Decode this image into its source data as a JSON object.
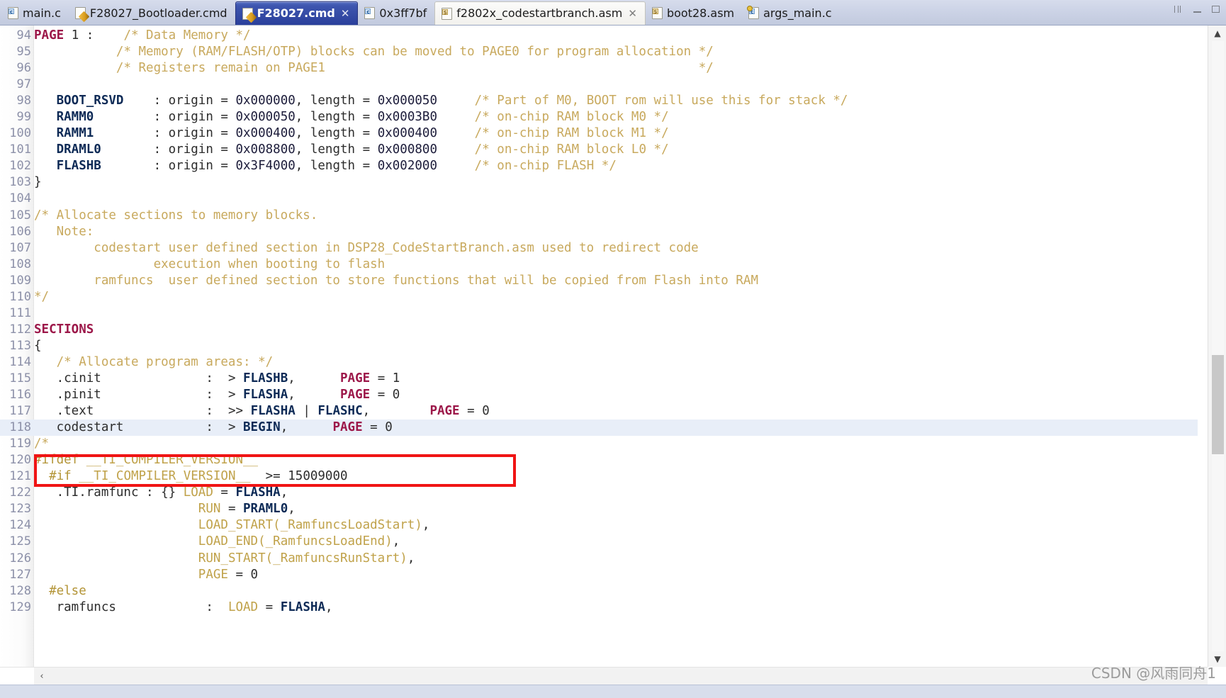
{
  "window": {
    "controls": [
      {
        "name": "restore-button",
        "glyph": "❐"
      },
      {
        "name": "minimize-button",
        "glyph": "—"
      },
      {
        "name": "maximize-button",
        "glyph": "▢"
      }
    ]
  },
  "tabs": [
    {
      "label": "main.c",
      "icon": "c-source-file-icon",
      "icon_kind": "c",
      "badge": "c",
      "active": false,
      "selected": false,
      "closable": false
    },
    {
      "label": "F28027_Bootloader.cmd",
      "icon": "linker-command-file-icon",
      "icon_kind": "cmd",
      "badge": "",
      "active": false,
      "selected": false,
      "closable": false
    },
    {
      "label": "F28027.cmd",
      "icon": "linker-command-file-icon",
      "icon_kind": "cmd",
      "badge": "",
      "active": true,
      "selected": true,
      "closable": true,
      "close_glyph": "✕"
    },
    {
      "label": "0x3ff7bf",
      "icon": "c-source-file-icon",
      "icon_kind": "c",
      "badge": "c",
      "active": false,
      "selected": false,
      "closable": false
    },
    {
      "label": "f2802x_codestartbranch.asm",
      "icon": "assembly-file-icon",
      "icon_kind": "asm",
      "badge": "S",
      "active": false,
      "selected": true,
      "closable": true,
      "close_glyph": "✕"
    },
    {
      "label": "boot28.asm",
      "icon": "assembly-file-icon",
      "icon_kind": "asm",
      "badge": "S",
      "active": false,
      "selected": false,
      "closable": false
    },
    {
      "label": "args_main.c",
      "icon": "c-source-file-icon",
      "icon_kind": "args",
      "badge": "c",
      "active": false,
      "selected": false,
      "closable": false
    }
  ],
  "editor": {
    "first_line": 94,
    "highlighted_line": 118,
    "annotation": {
      "shape": "rectangle",
      "color": "#f01414",
      "target_line": 118
    },
    "lines": [
      {
        "n": 94,
        "tokens": [
          {
            "t": "PAGE",
            "c": "k"
          },
          {
            "t": " 1 :    ",
            "c": "plain"
          },
          {
            "t": "/* Data Memory */",
            "c": "cmt"
          }
        ]
      },
      {
        "n": 95,
        "tokens": [
          {
            "t": "           ",
            "c": "plain"
          },
          {
            "t": "/* Memory (RAM/FLASH/OTP) blocks can be moved to PAGE0 for program allocation */",
            "c": "cmt"
          }
        ]
      },
      {
        "n": 96,
        "tokens": [
          {
            "t": "           ",
            "c": "plain"
          },
          {
            "t": "/* Registers remain on PAGE1                                                  */",
            "c": "cmt"
          }
        ]
      },
      {
        "n": 97,
        "tokens": []
      },
      {
        "n": 98,
        "tokens": [
          {
            "t": "   ",
            "c": "plain"
          },
          {
            "t": "BOOT_RSVD",
            "c": "ident"
          },
          {
            "t": "    : origin = ",
            "c": "plain"
          },
          {
            "t": "0x000000",
            "c": "num"
          },
          {
            "t": ", length = ",
            "c": "plain"
          },
          {
            "t": "0x000050",
            "c": "num"
          },
          {
            "t": "     ",
            "c": "plain"
          },
          {
            "t": "/* Part of M0, BOOT rom will use this for stack */",
            "c": "cmt"
          }
        ]
      },
      {
        "n": 99,
        "tokens": [
          {
            "t": "   ",
            "c": "plain"
          },
          {
            "t": "RAMM0",
            "c": "ident"
          },
          {
            "t": "        : origin = ",
            "c": "plain"
          },
          {
            "t": "0x000050",
            "c": "num"
          },
          {
            "t": ", length = ",
            "c": "plain"
          },
          {
            "t": "0x0003B0",
            "c": "num"
          },
          {
            "t": "     ",
            "c": "plain"
          },
          {
            "t": "/* on-chip RAM block M0 */",
            "c": "cmt"
          }
        ]
      },
      {
        "n": 100,
        "tokens": [
          {
            "t": "   ",
            "c": "plain"
          },
          {
            "t": "RAMM1",
            "c": "ident"
          },
          {
            "t": "        : origin = ",
            "c": "plain"
          },
          {
            "t": "0x000400",
            "c": "num"
          },
          {
            "t": ", length = ",
            "c": "plain"
          },
          {
            "t": "0x000400",
            "c": "num"
          },
          {
            "t": "     ",
            "c": "plain"
          },
          {
            "t": "/* on-chip RAM block M1 */",
            "c": "cmt"
          }
        ]
      },
      {
        "n": 101,
        "tokens": [
          {
            "t": "   ",
            "c": "plain"
          },
          {
            "t": "DRAML0",
            "c": "ident"
          },
          {
            "t": "       : origin = ",
            "c": "plain"
          },
          {
            "t": "0x008800",
            "c": "num"
          },
          {
            "t": ", length = ",
            "c": "plain"
          },
          {
            "t": "0x000800",
            "c": "num"
          },
          {
            "t": "     ",
            "c": "plain"
          },
          {
            "t": "/* on-chip RAM block L0 */",
            "c": "cmt"
          }
        ]
      },
      {
        "n": 102,
        "tokens": [
          {
            "t": "   ",
            "c": "plain"
          },
          {
            "t": "FLASHB",
            "c": "ident"
          },
          {
            "t": "       : origin = ",
            "c": "plain"
          },
          {
            "t": "0x3F4000",
            "c": "num"
          },
          {
            "t": ", length = ",
            "c": "plain"
          },
          {
            "t": "0x002000",
            "c": "num"
          },
          {
            "t": "     ",
            "c": "plain"
          },
          {
            "t": "/* on-chip FLASH */",
            "c": "cmt"
          }
        ]
      },
      {
        "n": 103,
        "tokens": [
          {
            "t": "}",
            "c": "plain"
          }
        ]
      },
      {
        "n": 104,
        "tokens": []
      },
      {
        "n": 105,
        "tokens": [
          {
            "t": "/* Allocate sections to memory blocks.",
            "c": "cmt"
          }
        ]
      },
      {
        "n": 106,
        "tokens": [
          {
            "t": "   Note:",
            "c": "cmt"
          }
        ]
      },
      {
        "n": 107,
        "tokens": [
          {
            "t": "        codestart user defined section in DSP28_CodeStartBranch.asm used to redirect code",
            "c": "cmt"
          }
        ]
      },
      {
        "n": 108,
        "tokens": [
          {
            "t": "                execution when booting to flash",
            "c": "cmt"
          }
        ]
      },
      {
        "n": 109,
        "tokens": [
          {
            "t": "        ramfuncs  user defined section to store functions that will be copied from Flash into RAM",
            "c": "cmt"
          }
        ]
      },
      {
        "n": 110,
        "tokens": [
          {
            "t": "*/",
            "c": "cmt"
          }
        ]
      },
      {
        "n": 111,
        "tokens": []
      },
      {
        "n": 112,
        "tokens": [
          {
            "t": "SECTIONS",
            "c": "k"
          }
        ]
      },
      {
        "n": 113,
        "tokens": [
          {
            "t": "{",
            "c": "plain"
          }
        ]
      },
      {
        "n": 114,
        "tokens": [
          {
            "t": "   ",
            "c": "plain"
          },
          {
            "t": "/* Allocate program areas: */",
            "c": "cmt"
          }
        ]
      },
      {
        "n": 115,
        "tokens": [
          {
            "t": "   .cinit",
            "c": "plain"
          },
          {
            "t": "              :  > ",
            "c": "plain"
          },
          {
            "t": "FLASHB",
            "c": "ident"
          },
          {
            "t": ",      ",
            "c": "plain"
          },
          {
            "t": "PAGE",
            "c": "k"
          },
          {
            "t": " = 1",
            "c": "plain"
          }
        ]
      },
      {
        "n": 116,
        "tokens": [
          {
            "t": "   .pinit",
            "c": "plain"
          },
          {
            "t": "              :  > ",
            "c": "plain"
          },
          {
            "t": "FLASHA",
            "c": "ident"
          },
          {
            "t": ",      ",
            "c": "plain"
          },
          {
            "t": "PAGE",
            "c": "k"
          },
          {
            "t": " = 0",
            "c": "plain"
          }
        ]
      },
      {
        "n": 117,
        "tokens": [
          {
            "t": "   .text",
            "c": "plain"
          },
          {
            "t": "               :  >> ",
            "c": "plain"
          },
          {
            "t": "FLASHA",
            "c": "ident"
          },
          {
            "t": " | ",
            "c": "plain"
          },
          {
            "t": "FLASHC",
            "c": "ident"
          },
          {
            "t": ",        ",
            "c": "plain"
          },
          {
            "t": "PAGE",
            "c": "k"
          },
          {
            "t": " = 0",
            "c": "plain"
          }
        ]
      },
      {
        "n": 118,
        "tokens": [
          {
            "t": "   codestart",
            "c": "plain"
          },
          {
            "t": "           :  > ",
            "c": "plain"
          },
          {
            "t": "BEGIN",
            "c": "ident"
          },
          {
            "t": ",      ",
            "c": "plain"
          },
          {
            "t": "PAGE",
            "c": "k"
          },
          {
            "t": " = 0",
            "c": "plain"
          }
        ]
      },
      {
        "n": 119,
        "tokens": [
          {
            "t": "/*",
            "c": "cmt"
          }
        ]
      },
      {
        "n": 120,
        "tokens": [
          {
            "t": "#ifdef",
            "c": "pre"
          },
          {
            "t": " __TI_COMPILER_VERSION__",
            "c": "fn"
          }
        ]
      },
      {
        "n": 121,
        "tokens": [
          {
            "t": "  ",
            "c": "plain"
          },
          {
            "t": "#if",
            "c": "pre"
          },
          {
            "t": " __TI_COMPILER_VERSION__",
            "c": "fn"
          },
          {
            "t": "  >= 15009000",
            "c": "plain"
          }
        ]
      },
      {
        "n": 122,
        "tokens": [
          {
            "t": "   .TI.ramfunc : {} ",
            "c": "plain"
          },
          {
            "t": "LOAD",
            "c": "fn"
          },
          {
            "t": " = ",
            "c": "plain"
          },
          {
            "t": "FLASHA",
            "c": "ident"
          },
          {
            "t": ",",
            "c": "plain"
          }
        ]
      },
      {
        "n": 123,
        "tokens": [
          {
            "t": "                      ",
            "c": "plain"
          },
          {
            "t": "RUN",
            "c": "fn"
          },
          {
            "t": " = ",
            "c": "plain"
          },
          {
            "t": "PRAML0",
            "c": "ident"
          },
          {
            "t": ",",
            "c": "plain"
          }
        ]
      },
      {
        "n": 124,
        "tokens": [
          {
            "t": "                      ",
            "c": "plain"
          },
          {
            "t": "LOAD_START(_RamfuncsLoadStart)",
            "c": "fn"
          },
          {
            "t": ",",
            "c": "plain"
          }
        ]
      },
      {
        "n": 125,
        "tokens": [
          {
            "t": "                      ",
            "c": "plain"
          },
          {
            "t": "LOAD_END(_RamfuncsLoadEnd)",
            "c": "fn"
          },
          {
            "t": ",",
            "c": "plain"
          }
        ]
      },
      {
        "n": 126,
        "tokens": [
          {
            "t": "                      ",
            "c": "plain"
          },
          {
            "t": "RUN_START(_RamfuncsRunStart)",
            "c": "fn"
          },
          {
            "t": ",",
            "c": "plain"
          }
        ]
      },
      {
        "n": 127,
        "tokens": [
          {
            "t": "                      ",
            "c": "plain"
          },
          {
            "t": "PAGE",
            "c": "fn"
          },
          {
            "t": " = 0",
            "c": "plain"
          }
        ]
      },
      {
        "n": 128,
        "tokens": [
          {
            "t": "  ",
            "c": "plain"
          },
          {
            "t": "#else",
            "c": "pre"
          }
        ]
      },
      {
        "n": 129,
        "tokens": [
          {
            "t": "   ramfuncs",
            "c": "plain"
          },
          {
            "t": "            :  ",
            "c": "plain"
          },
          {
            "t": "LOAD",
            "c": "fn"
          },
          {
            "t": " = ",
            "c": "plain"
          },
          {
            "t": "FLASHA",
            "c": "ident"
          },
          {
            "t": ",",
            "c": "plain"
          }
        ]
      }
    ]
  },
  "scrollbars": {
    "vertical": {
      "up_glyph": "▲",
      "down_glyph": "▼"
    },
    "horizontal": {
      "left_glyph": "‹",
      "right_glyph": "›"
    }
  },
  "watermark": {
    "text": "CSDN @风雨同舟1"
  }
}
